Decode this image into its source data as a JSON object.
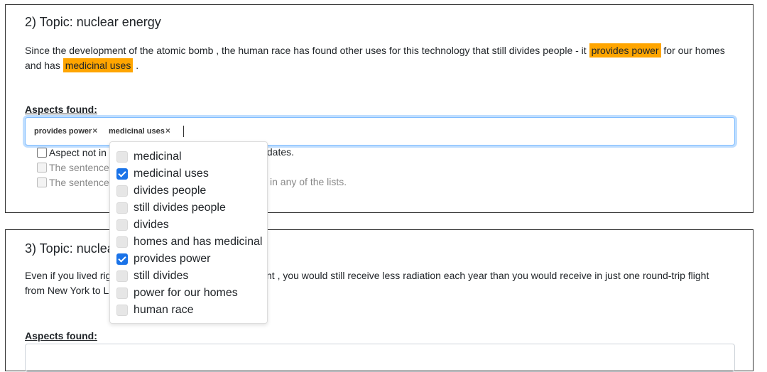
{
  "card1": {
    "title": "2) Topic: nuclear energy",
    "sentence_a": "Since the development of the atomic bomb , the human race has found other uses for this technology that still divides people - it ",
    "hl1": "provides power",
    "sentence_b": " for our homes and has ",
    "hl2": "medicinal uses",
    "sentence_c": " .",
    "aspects_label": "Aspects found:",
    "tags": [
      "provides power",
      "medicinal uses"
    ],
    "tag_remove": "×",
    "checks": [
      {
        "label": "Aspect not in",
        "suffix": "didates.",
        "disabled": false
      },
      {
        "label": "The sentence",
        "suffix": "",
        "disabled": true
      },
      {
        "label": "The sentence",
        "suffix": "in any of the lists.",
        "disabled": true
      }
    ]
  },
  "card2": {
    "title": "3) Topic: nuclea",
    "sentence_a": "Even if you lived rig",
    "sentence_b": "nt , you would still receive less radiation each year than you would receive in just one round-trip flight",
    "sentence_c": "from New York to L",
    "aspects_label": "Aspects found:"
  },
  "dropdown": {
    "options": [
      {
        "label": "medicinal",
        "checked": false
      },
      {
        "label": "medicinal uses",
        "checked": true
      },
      {
        "label": "divides people",
        "checked": false
      },
      {
        "label": "still divides people",
        "checked": false
      },
      {
        "label": "divides",
        "checked": false
      },
      {
        "label": "homes and has medicinal",
        "checked": false
      },
      {
        "label": "provides power",
        "checked": true
      },
      {
        "label": "still divides",
        "checked": false
      },
      {
        "label": "power for our homes",
        "checked": false
      },
      {
        "label": "human race",
        "checked": false
      }
    ]
  },
  "colors": {
    "highlight": "#ffa500",
    "checkbox_on": "#1a73e8",
    "focus_border": "#80bdff"
  }
}
